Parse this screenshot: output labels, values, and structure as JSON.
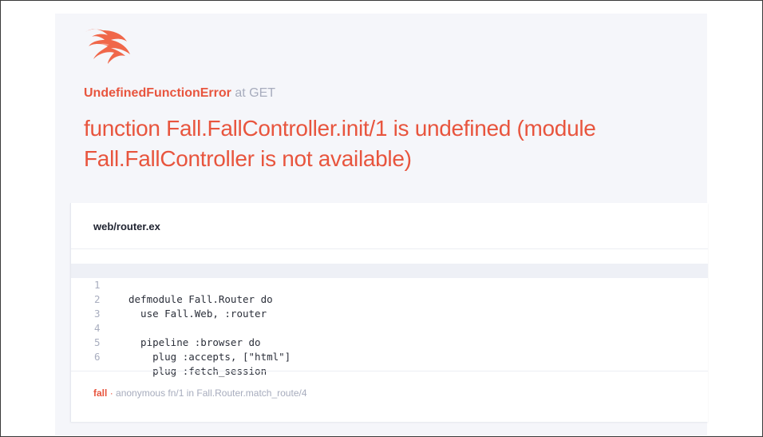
{
  "error": {
    "type": "UndefinedFunctionError",
    "at": "at GET",
    "message": "function Fall.FallController.init/1 is undefined (module Fall.FallController is not available)"
  },
  "source": {
    "file": "web/router.ex",
    "lines": [
      {
        "num": "1",
        "code": "defmodule Fall.Router do",
        "highlighted": true
      },
      {
        "num": "2",
        "code": "  use Fall.Web, :router",
        "highlighted": false
      },
      {
        "num": "3",
        "code": "",
        "highlighted": false
      },
      {
        "num": "4",
        "code": "  pipeline :browser do",
        "highlighted": false
      },
      {
        "num": "5",
        "code": "    plug :accepts, [\"html\"]",
        "highlighted": false
      },
      {
        "num": "6",
        "code": "    plug :fetch_session",
        "highlighted": false
      }
    ]
  },
  "stack": {
    "app": "fall",
    "separator": "·",
    "function": "anonymous fn/1 in Fall.Router.match_route/4"
  },
  "colors": {
    "accent": "#e8553e",
    "muted": "#a7acbd",
    "panel": "#f5f6fa"
  },
  "icons": {
    "logo": "phoenix-logo-icon"
  }
}
